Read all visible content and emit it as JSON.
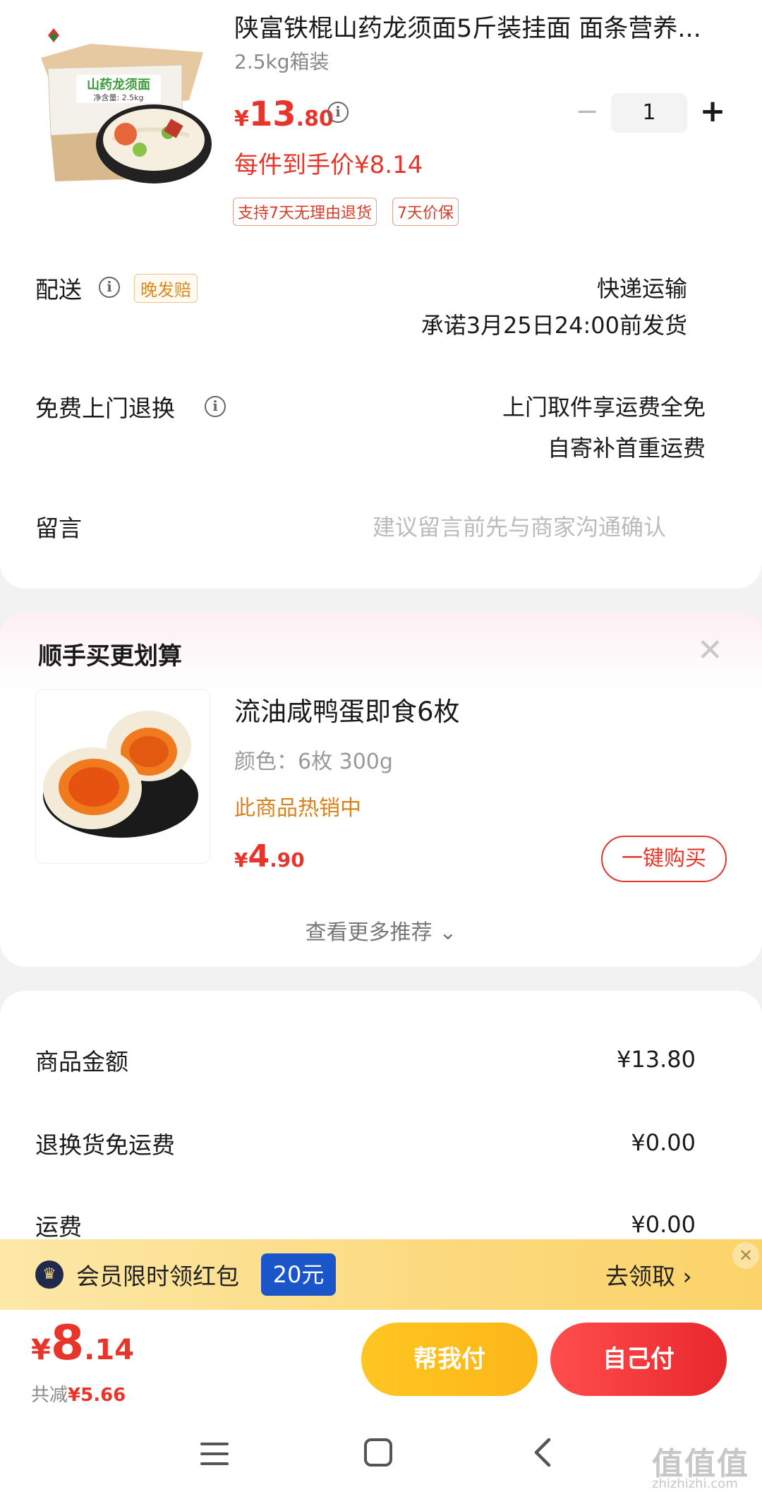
{
  "product": {
    "title": "陕富铁棍山药龙须面5斤装挂面 面条营养...",
    "spec": "2.5kg箱装",
    "image_box_label": "山药龙须面",
    "image_box_weight": "净含量: 2.5kg",
    "price_currency": "¥",
    "price_int": "13",
    "price_dec": ".80",
    "final_price": "每件到手价¥8.14",
    "tags": [
      "支持7天无理由退货",
      "7天价保"
    ],
    "quantity": "1",
    "minus": "−",
    "plus": "+"
  },
  "delivery": {
    "label": "配送",
    "tag": "晚发赔",
    "method": "快递运输",
    "promise": "承诺3月25日24:00前发货"
  },
  "returns": {
    "label": "免费上门退换",
    "line1": "上门取件享运费全免",
    "line2": "自寄补首重运费"
  },
  "note": {
    "label": "留言",
    "placeholder": "建议留言前先与商家沟通确认"
  },
  "recommend": {
    "title": "顺手买更划算",
    "item_name": "流油咸鸭蛋即食6枚",
    "item_spec": "颜色：6枚 300g",
    "item_hot": "此商品热销中",
    "price_currency": "¥",
    "price_int": "4",
    "price_dec": ".90",
    "buy_label": "一键购买",
    "more_label": "查看更多推荐 ⌄"
  },
  "summary": {
    "rows": [
      {
        "label": "商品金额",
        "value": "¥13.80"
      },
      {
        "label": "退换货免运费",
        "value": "¥0.00"
      },
      {
        "label": "运费",
        "value": "¥0.00"
      }
    ]
  },
  "banner": {
    "text": "会员限时领红包",
    "amount": "20元",
    "claim": "去领取 ›",
    "close": "✕"
  },
  "paybar": {
    "currency": "¥",
    "total_int": "8",
    "total_dec": ".14",
    "saved_label": "共减",
    "saved_value": "¥5.66",
    "help_pay": "帮我付",
    "self_pay": "自己付"
  },
  "watermark": {
    "main": "值值值",
    "sub": "zhizhizhi.com"
  },
  "colors": {
    "accent_red": "#e8352b",
    "accent_orange": "#d9821b",
    "banner_yellow": "#fcd97d",
    "help_button": "#ffc623",
    "self_button": "#e8282e",
    "amount_tag_blue": "#1a55c9"
  }
}
